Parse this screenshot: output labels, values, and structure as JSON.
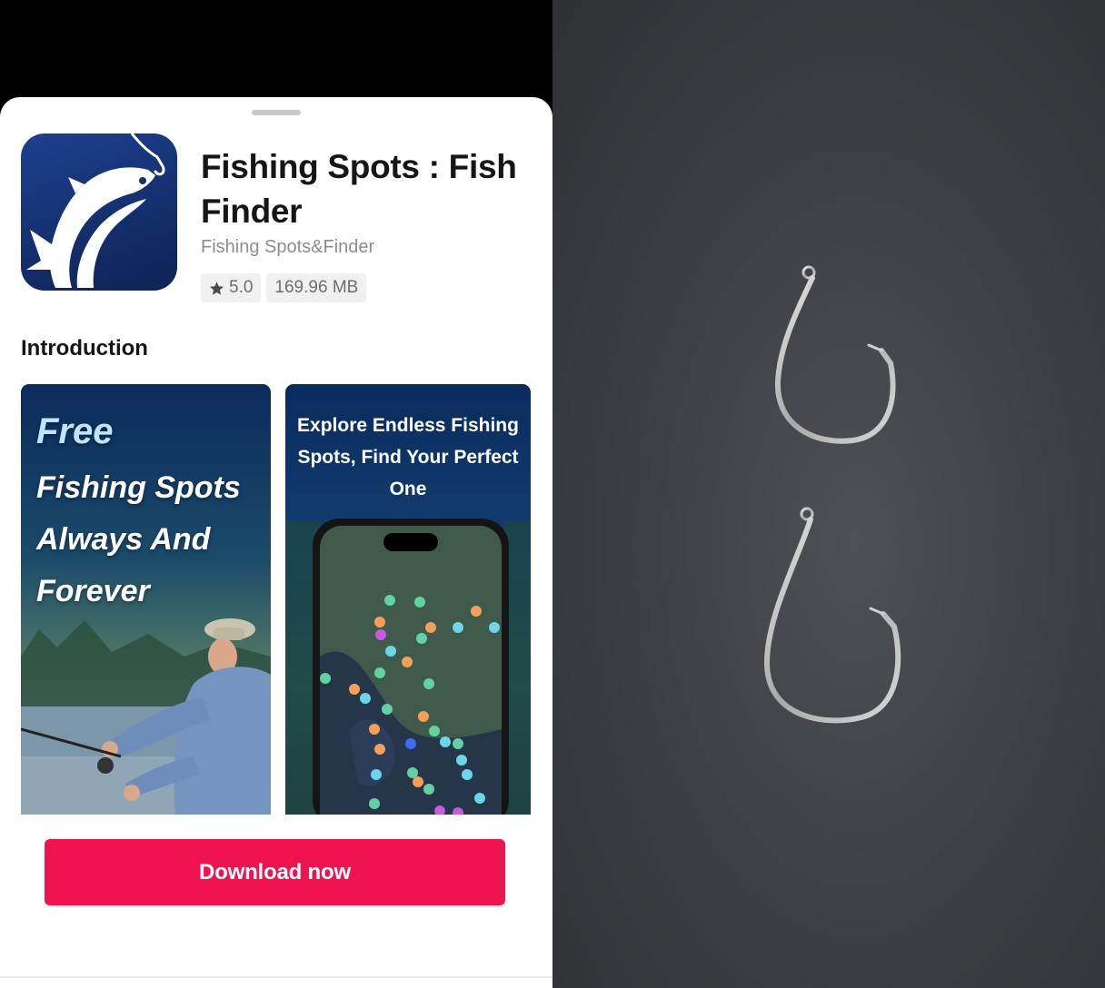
{
  "app": {
    "title": "Fishing Spots : Fish Finder",
    "developer": "Fishing Spots&Finder",
    "rating": "5.0",
    "size": "169.96 MB",
    "icon": "fish-hook-logo-icon"
  },
  "introduction": {
    "title": "Introduction",
    "screenshots": [
      {
        "free": "Free",
        "lines": "Fishing Spots Always And Forever"
      },
      {
        "lines": "Explore Endless Fishing Spots, Find Your Perfect One"
      }
    ]
  },
  "actions": {
    "download_label": "Download now"
  },
  "colors": {
    "accent": "#ee1450",
    "icon_background": "#15306f",
    "badge_background": "#f0f0f0"
  }
}
